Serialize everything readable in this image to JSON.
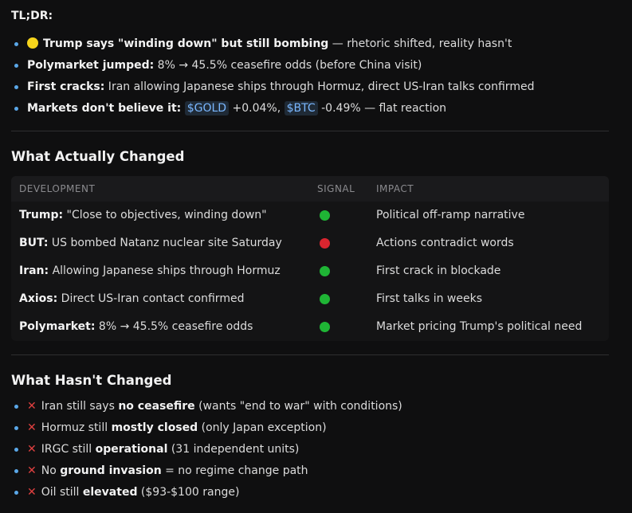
{
  "tldr": {
    "label": "TL;DR:",
    "items": [
      {
        "bold": "Trump says \"winding down\" but still bombing",
        "rest": " — rhetoric shifted, reality hasn't"
      },
      {
        "bold": "Polymarket jumped:",
        "rest": " 8% → 45.5% ceasefire odds (before China visit)"
      },
      {
        "bold": "First cracks:",
        "rest": " Iran allowing Japanese ships through Hormuz, direct US-Iran talks confirmed"
      },
      {
        "bold": "Markets don't believe it:",
        "gold_tag": "$GOLD",
        "gold_change": " +0.04%, ",
        "btc_tag": "$BTC",
        "btc_change": " -0.49% — flat reaction"
      }
    ]
  },
  "changed": {
    "heading": "What Actually Changed",
    "columns": [
      "DEVELOPMENT",
      "SIGNAL",
      "IMPACT"
    ],
    "rows": [
      {
        "bold": "Trump:",
        "rest": " \"Close to objectives, winding down\"",
        "signal": "green",
        "impact": "Political off-ramp narrative"
      },
      {
        "bold": "BUT:",
        "rest": " US bombed Natanz nuclear site Saturday",
        "signal": "red",
        "impact": "Actions contradict words"
      },
      {
        "bold": "Iran:",
        "rest": " Allowing Japanese ships through Hormuz",
        "signal": "green",
        "impact": "First crack in blockade"
      },
      {
        "bold": "Axios:",
        "rest": " Direct US-Iran contact confirmed",
        "signal": "green",
        "impact": "First talks in weeks"
      },
      {
        "bold": "Polymarket:",
        "rest": " 8% → 45.5% ceasefire odds",
        "signal": "green",
        "impact": "Market pricing Trump's political need"
      }
    ]
  },
  "unchanged": {
    "heading": "What Hasn't Changed",
    "items": [
      {
        "pre": "Iran still says ",
        "bold": "no ceasefire",
        "post": " (wants \"end to war\" with conditions)"
      },
      {
        "pre": "Hormuz still ",
        "bold": "mostly closed",
        "post": " (only Japan exception)"
      },
      {
        "pre": "IRGC still ",
        "bold": "operational",
        "post": " (31 independent units)"
      },
      {
        "pre": "No ",
        "bold": "ground invasion",
        "post": " = no regime change path"
      },
      {
        "pre": "Oil still ",
        "bold": "elevated",
        "post": " ($93-$100 range)"
      }
    ]
  },
  "colors": {
    "accent_blue": "#5aa7e8",
    "signal_green": "#1fb535",
    "signal_red": "#d9252f",
    "cross_red": "#e04040",
    "yellow": "#f6d41c"
  },
  "icons": {
    "positive": "yellow-dot-icon",
    "negative": "cross-icon"
  }
}
